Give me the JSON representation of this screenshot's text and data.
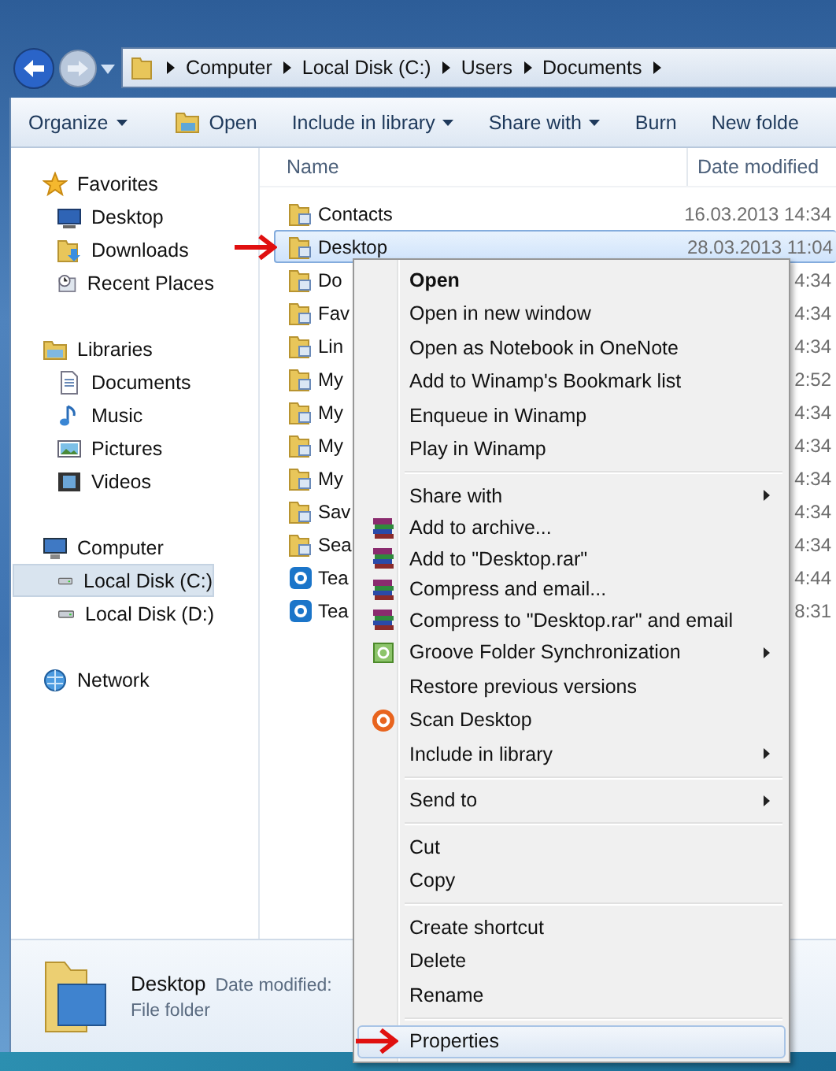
{
  "address_bar": {
    "crumbs": [
      "Computer",
      "Local Disk (C:)",
      "Users",
      "Documents"
    ]
  },
  "toolbar": [
    {
      "label": "Organize",
      "dropdown": true
    },
    {
      "label": "Open",
      "dropdown": false
    },
    {
      "label": "Include in library",
      "dropdown": true
    },
    {
      "label": "Share with",
      "dropdown": true
    },
    {
      "label": "Burn",
      "dropdown": false
    },
    {
      "label": "New folde",
      "dropdown": false
    }
  ],
  "sidebar": {
    "groups": [
      {
        "label": "Favorites",
        "items": [
          {
            "label": "Desktop",
            "selected": false
          },
          {
            "label": "Downloads",
            "selected": false
          },
          {
            "label": "Recent Places",
            "selected": false
          }
        ]
      },
      {
        "label": "Libraries",
        "items": [
          {
            "label": "Documents",
            "selected": false
          },
          {
            "label": "Music",
            "selected": false
          },
          {
            "label": "Pictures",
            "selected": false
          },
          {
            "label": "Videos",
            "selected": false
          }
        ]
      },
      {
        "label": "Computer",
        "items": [
          {
            "label": "Local Disk (C:)",
            "selected": true
          },
          {
            "label": "Local Disk (D:)",
            "selected": false
          }
        ]
      },
      {
        "label": "Network"
      }
    ]
  },
  "file_list": {
    "columns": [
      "Name",
      "Date modified"
    ],
    "rows": [
      {
        "name": "Contacts",
        "date": "16.03.2013 14:34",
        "selected": false
      },
      {
        "name": "Desktop",
        "date": "28.03.2013 11:04",
        "selected": true
      },
      {
        "name": "Do",
        "date": "4:34",
        "selected": false
      },
      {
        "name": "Fav",
        "date": "4:34",
        "selected": false
      },
      {
        "name": "Lin",
        "date": "4:34",
        "selected": false
      },
      {
        "name": "My",
        "date": "2:52",
        "selected": false
      },
      {
        "name": "My",
        "date": "4:34",
        "selected": false
      },
      {
        "name": "My",
        "date": "4:34",
        "selected": false
      },
      {
        "name": "My",
        "date": "4:34",
        "selected": false
      },
      {
        "name": "Sav",
        "date": "4:34",
        "selected": false
      },
      {
        "name": "Sea",
        "date": "4:34",
        "selected": false
      },
      {
        "name": "Tea",
        "date": "4:44",
        "selected": false
      },
      {
        "name": "Tea",
        "date": "8:31",
        "selected": false
      }
    ]
  },
  "context_menu": {
    "groups": [
      [
        {
          "label": "Open",
          "default": true,
          "submenu": false,
          "selected": false
        },
        {
          "label": "Open in new window",
          "default": false,
          "submenu": false,
          "selected": false
        },
        {
          "label": "Open as Notebook in OneNote",
          "default": false,
          "submenu": false,
          "selected": false
        },
        {
          "label": "Add to Winamp's Bookmark list",
          "default": false,
          "submenu": false,
          "selected": false
        },
        {
          "label": "Enqueue in Winamp",
          "default": false,
          "submenu": false,
          "selected": false
        },
        {
          "label": "Play in Winamp",
          "default": false,
          "submenu": false,
          "selected": false
        }
      ],
      [
        {
          "label": "Share with",
          "default": false,
          "submenu": true,
          "selected": false
        },
        {
          "label": "Add to archive...",
          "default": false,
          "submenu": false,
          "selected": false
        },
        {
          "label": "Add to \"Desktop.rar\"",
          "default": false,
          "submenu": false,
          "selected": false
        },
        {
          "label": "Compress and email...",
          "default": false,
          "submenu": false,
          "selected": false
        },
        {
          "label": "Compress to \"Desktop.rar\" and email",
          "default": false,
          "submenu": false,
          "selected": false
        },
        {
          "label": "Groove Folder Synchronization",
          "default": false,
          "submenu": true,
          "selected": false
        },
        {
          "label": "Restore previous versions",
          "default": false,
          "submenu": false,
          "selected": false
        },
        {
          "label": "Scan Desktop",
          "default": false,
          "submenu": false,
          "selected": false
        },
        {
          "label": "Include in library",
          "default": false,
          "submenu": true,
          "selected": false
        }
      ],
      [
        {
          "label": "Send to",
          "default": false,
          "submenu": true,
          "selected": false
        }
      ],
      [
        {
          "label": "Cut",
          "default": false,
          "submenu": false,
          "selected": false
        },
        {
          "label": "Copy",
          "default": false,
          "submenu": false,
          "selected": false
        }
      ],
      [
        {
          "label": "Create shortcut",
          "default": false,
          "submenu": false,
          "selected": false
        },
        {
          "label": "Delete",
          "default": false,
          "submenu": false,
          "selected": false
        },
        {
          "label": "Rename",
          "default": false,
          "submenu": false,
          "selected": false
        }
      ],
      [
        {
          "label": "Properties",
          "default": false,
          "submenu": false,
          "selected": true
        }
      ]
    ]
  },
  "details_pane": {
    "name": "Desktop",
    "date_label": "Date modified:",
    "type": "File folder"
  }
}
